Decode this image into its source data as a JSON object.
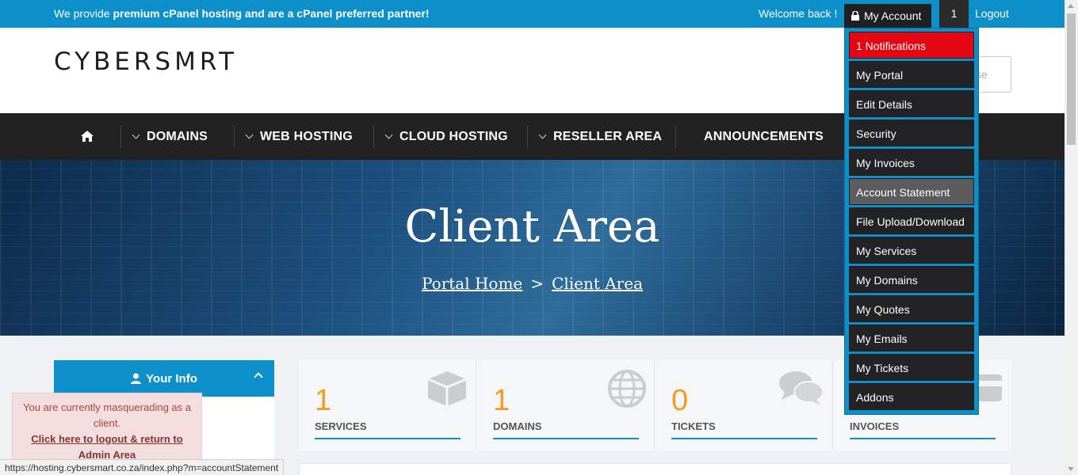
{
  "topbar": {
    "promo_prefix": "We provide ",
    "promo_bold": "premium cPanel hosting and are a cPanel preferred partner!",
    "welcome": "Welcome back !",
    "my_account": "My Account",
    "notif_count": "1",
    "logout": "Logout"
  },
  "header": {
    "logo": "CYBERSMRT",
    "search_placeholder": "se"
  },
  "nav": {
    "items": [
      "DOMAINS",
      "WEB HOSTING",
      "CLOUD HOSTING",
      "RESELLER AREA",
      "ANNOUNCEMENTS"
    ]
  },
  "hero": {
    "title": "Client Area",
    "crumb_home": "Portal Home",
    "crumb_sep": ">",
    "crumb_current": "Client Area"
  },
  "sidebar": {
    "your_info": "Your Info"
  },
  "stats": [
    {
      "count": "1",
      "label": "SERVICES",
      "icon": "box-icon"
    },
    {
      "count": "1",
      "label": "DOMAINS",
      "icon": "globe-icon"
    },
    {
      "count": "0",
      "label": "TICKETS",
      "icon": "comments-icon"
    },
    {
      "count": "",
      "label": "INVOICES",
      "icon": "credit-card-icon"
    }
  ],
  "masquerade": {
    "message": "You are currently masquerading as a client.",
    "link": "Click here to logout & return to Admin Area"
  },
  "status_url": "https://hosting.cybersmart.co.za/index.php?m=accountStatement",
  "dropdown": {
    "items": [
      "1 Notifications",
      "My Portal",
      "Edit Details",
      "Security",
      "My Invoices",
      "Account Statement",
      "File Upload/Download",
      "My Services",
      "My Domains",
      "My Quotes",
      "My Emails",
      "My Tickets",
      "Addons"
    ]
  },
  "colors": {
    "brand_blue": "#0d8fca",
    "nav_dark": "#222223",
    "accent_orange": "#f39c20",
    "notification_red": "#e30613"
  }
}
